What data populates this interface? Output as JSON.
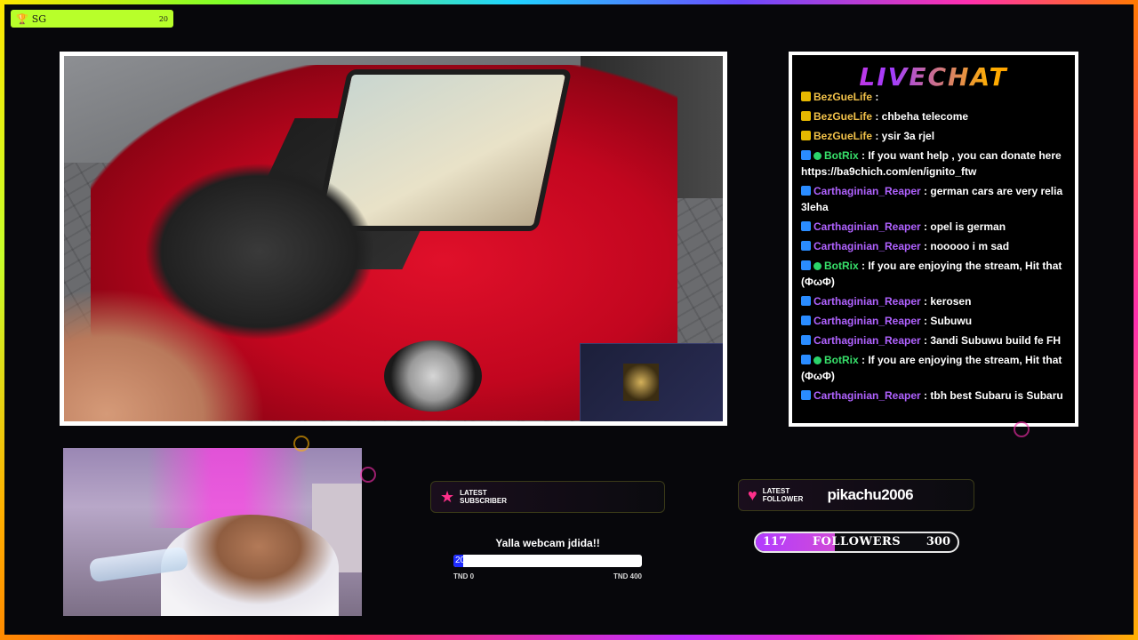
{
  "badge": {
    "label": "SG",
    "count": "20"
  },
  "chat": {
    "title": "LIVECHAT",
    "messages": [
      {
        "badge": "crown",
        "user": "BezGueLife",
        "text": ":",
        "user_color": "gold"
      },
      {
        "badge": "crown",
        "user": "BezGueLife",
        "text": ": chbeha telecome",
        "user_color": "gold"
      },
      {
        "badge": "crown",
        "user": "BezGueLife",
        "text": ": ysir 3a rjel",
        "user_color": "gold"
      },
      {
        "badge": "prime",
        "user": "BotRix",
        "text": ": If you want help , you can donate here https://ba9chich.com/en/ignito_ftw",
        "user_color": "green",
        "verified": true
      },
      {
        "badge": "prime",
        "user": "Carthaginian_Reaper",
        "text": ": german cars are very relia 3leha",
        "user_color": "purple"
      },
      {
        "badge": "prime",
        "user": "Carthaginian_Reaper",
        "text": ": opel is german",
        "user_color": "purple"
      },
      {
        "badge": "prime",
        "user": "Carthaginian_Reaper",
        "text": ": nooooo i m sad",
        "user_color": "purple"
      },
      {
        "badge": "prime",
        "user": "BotRix",
        "text": ": If you are enjoying the stream, Hit that (ΦωΦ)",
        "user_color": "green",
        "verified": true
      },
      {
        "badge": "prime",
        "user": "Carthaginian_Reaper",
        "text": ": kerosen",
        "user_color": "purple"
      },
      {
        "badge": "prime",
        "user": "Carthaginian_Reaper",
        "text": ": Subuwu",
        "user_color": "purple"
      },
      {
        "badge": "prime",
        "user": "Carthaginian_Reaper",
        "text": ": 3andi Subuwu build fe FH",
        "user_color": "purple"
      },
      {
        "badge": "prime",
        "user": "BotRix",
        "text": ": If you are enjoying the stream, Hit that (ΦωΦ)",
        "user_color": "green",
        "verified": true
      },
      {
        "badge": "prime",
        "user": "Carthaginian_Reaper",
        "text": ": tbh best Subaru is Subaru",
        "user_color": "purple"
      }
    ]
  },
  "latest_subscriber": {
    "label_line1": "LATEST",
    "label_line2": "SUBSCRIBER",
    "value": ""
  },
  "latest_follower": {
    "label_line1": "LATEST",
    "label_line2": "FOLLOWER",
    "value": "pikachu2006"
  },
  "donation_goal": {
    "title": "Yalla webcam jdida!!",
    "current_label": "20",
    "progress": 0.05,
    "min_label": "TND 0",
    "max_label": "TND 400"
  },
  "followers_goal": {
    "current": "117",
    "label": "FOLLOWERS",
    "target": "300",
    "progress": 0.39
  },
  "colors": {
    "badge_bg": "#b8ff2a",
    "accent_pink": "#ff2fb0",
    "accent_purple": "#b062ff",
    "donation_fill": "#1f2cff"
  }
}
